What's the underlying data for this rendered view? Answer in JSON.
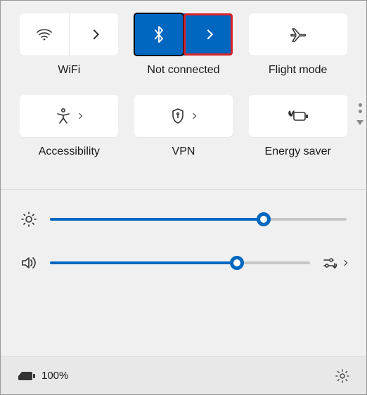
{
  "tiles": {
    "wifi": {
      "label": "WiFi"
    },
    "bt": {
      "label": "Not connected"
    },
    "flight": {
      "label": "Flight mode"
    },
    "access": {
      "label": "Accessibility"
    },
    "vpn": {
      "label": "VPN"
    },
    "energy": {
      "label": "Energy saver"
    }
  },
  "sliders": {
    "brightness": {
      "value": 72
    },
    "volume": {
      "value": 72
    }
  },
  "footer": {
    "battery": "100%"
  },
  "colors": {
    "accent": "#0067c0"
  }
}
